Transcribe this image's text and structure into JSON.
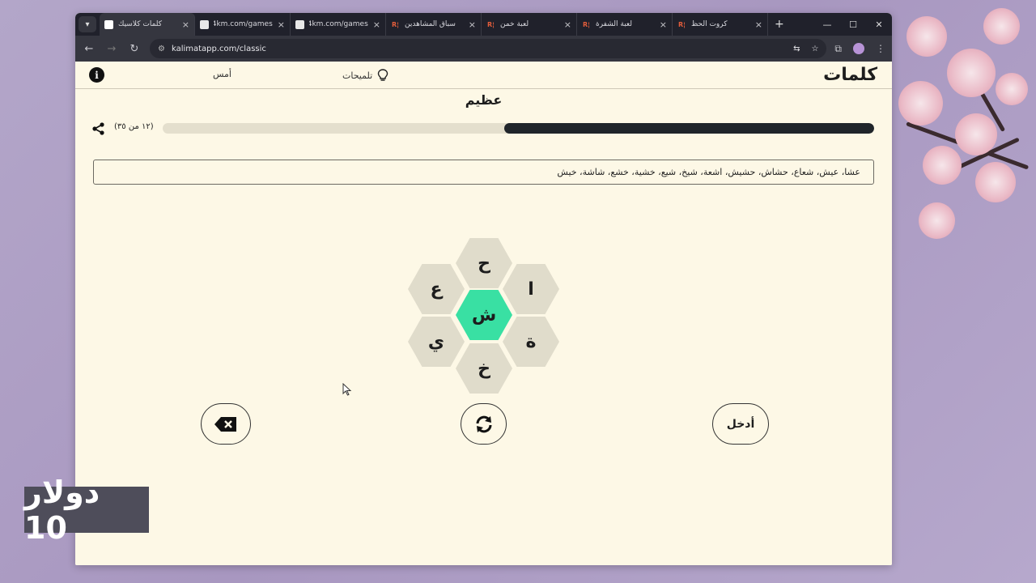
{
  "browser": {
    "tabs": [
      {
        "title": "كلمات كلاسيك",
        "favicon": "k",
        "active": true
      },
      {
        "title": "e4km.com/games",
        "favicon": "e",
        "active": false
      },
      {
        "title": "e4km.com/games",
        "favicon": "e",
        "active": false
      },
      {
        "title": "سباق المشاهدين",
        "favicon": "r",
        "active": false
      },
      {
        "title": "لعبة خمن",
        "favicon": "r",
        "active": false
      },
      {
        "title": "لعبة الشفرة",
        "favicon": "r",
        "active": false
      },
      {
        "title": "كروت الحظ",
        "favicon": "r",
        "active": false
      }
    ],
    "url": "kalimatapp.com/classic",
    "favicon_rj": "R¦",
    "icons": {
      "back": "←",
      "forward": "→",
      "reload": "↻",
      "close": "×",
      "new_tab": "+",
      "minimize": "—",
      "maximize": "☐",
      "window_close": "✕",
      "tab_search": "▾",
      "site_info": "⚙",
      "translate": "⇆",
      "star": "☆",
      "extensions": "⧉",
      "menu": "⋮"
    }
  },
  "app": {
    "logo": "كلمات",
    "hints_label": "تلميحات",
    "yesterday_label": "أمس",
    "info_icon": "i",
    "rank": "عظيم",
    "score_text": "(١٢ من ٣٥)",
    "progress": 0.52,
    "found_words": "عشا، عيش، شعاع، حشاش، حشيش، اشعة، شيخ، شيع، خشية، خشع، شاشة، خيش",
    "letters": {
      "center": "ش",
      "top": "ح",
      "top_right": "ا",
      "bottom_right": "ة",
      "bottom": "خ",
      "bottom_left": "ي",
      "top_left": "ع"
    },
    "enter_label": "أدخل"
  },
  "overlay": {
    "price_text": "دولار 10"
  },
  "colors": {
    "center_hex": "#39e0a3",
    "outer_hex": "#e0dccb",
    "progress_fill": "#20252a",
    "page_bg": "#fdf8e6"
  }
}
